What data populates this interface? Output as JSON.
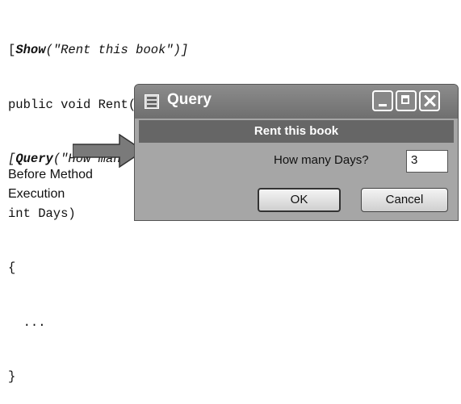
{
  "code": {
    "line1_prefix": "[",
    "line1_kw": "Show",
    "line1_rest": "(\"Rent this book\")]",
    "line2": "public void Rent(",
    "line3_prefix": "[",
    "line3_kw": "Query",
    "line3_rest": "(\"How many Days?\", QueryKind.allways)]",
    "line4": "int Days)",
    "line5": "{",
    "line6": "  ...",
    "line7": "}"
  },
  "caption": {
    "line1": "Before Method",
    "line2": "Execution"
  },
  "dialog": {
    "title": "Query",
    "banner": "Rent this book",
    "prompt": "How many Days?",
    "input_value": "3",
    "ok_label": "OK",
    "cancel_label": "Cancel"
  },
  "icons": {
    "window_icon": "form-icon",
    "minimize": "minimize-icon",
    "maximize": "maximize-icon",
    "close": "close-icon",
    "arrow": "right-arrow-icon"
  }
}
